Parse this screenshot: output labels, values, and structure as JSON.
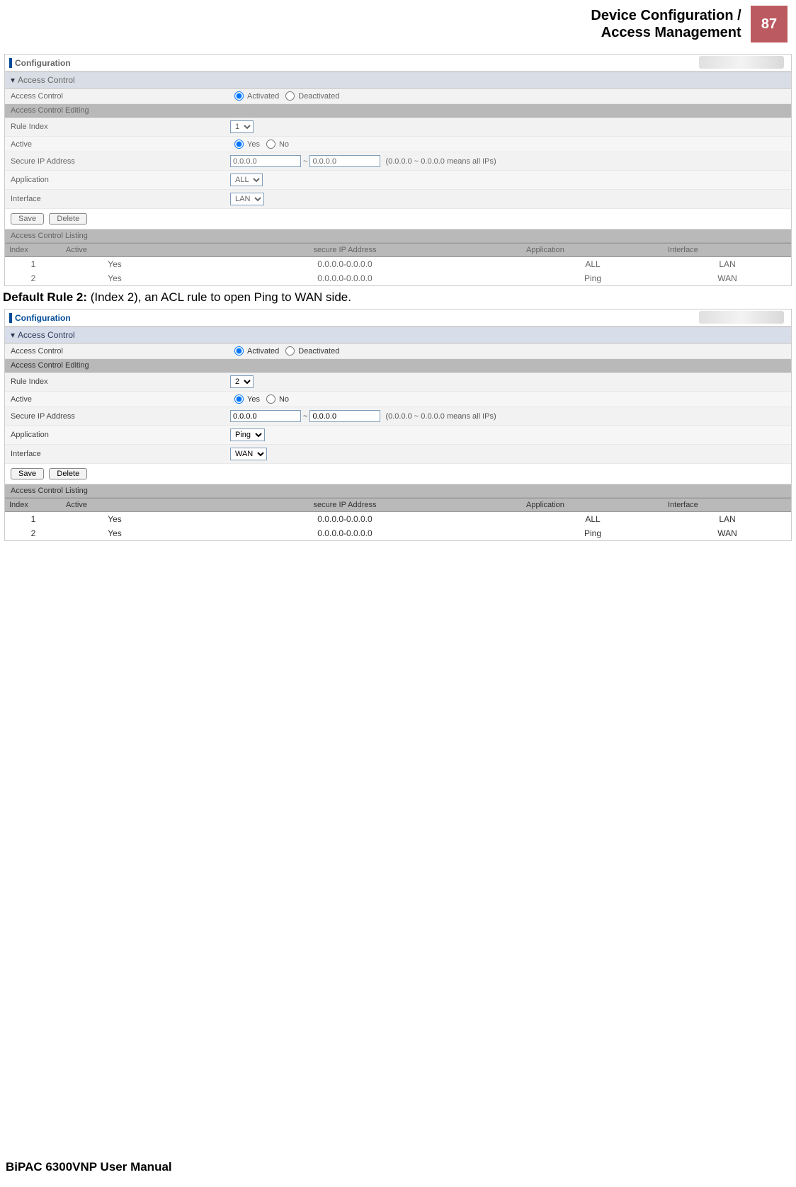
{
  "header": {
    "line1": "Device Configuration /",
    "line2": "Access Management",
    "page_no": "87"
  },
  "defaultRuleText": {
    "bold": "Default Rule 2:",
    "rest": " (Index 2), an ACL rule to open Ping to WAN side."
  },
  "footer": "BiPAC 6300VNP User Manual",
  "shot1": {
    "cfg": "Configuration",
    "sec": "Access Control",
    "labels": {
      "accessControl": "Access Control",
      "editing": "Access Control Editing",
      "ruleIndex": "Rule Index",
      "active": "Active",
      "secureIp": "Secure IP Address",
      "application": "Application",
      "interface": "Interface",
      "listing": "Access Control Listing"
    },
    "radios": {
      "activated": "Activated",
      "deactivated": "Deactivated",
      "yes": "Yes",
      "no": "No"
    },
    "ruleIndex": "1",
    "ip1": "0.0.0.0",
    "ipSep": "~",
    "ip2": "0.0.0.0",
    "ipHint": "(0.0.0.0 ~ 0.0.0.0 means all IPs)",
    "application": "ALL",
    "interface": "LAN",
    "buttons": {
      "save": "Save",
      "delete": "Delete"
    },
    "listHead": {
      "idx": "Index",
      "act": "Active",
      "ip": "secure IP Address",
      "app": "Application",
      "int": "Interface"
    },
    "list": [
      {
        "idx": "1",
        "act": "Yes",
        "ip": "0.0.0.0-0.0.0.0",
        "app": "ALL",
        "int": "LAN"
      },
      {
        "idx": "2",
        "act": "Yes",
        "ip": "0.0.0.0-0.0.0.0",
        "app": "Ping",
        "int": "WAN"
      }
    ]
  },
  "shot2": {
    "cfg": "Configuration",
    "sec": "Access Control",
    "labels": {
      "accessControl": "Access Control",
      "editing": "Access Control Editing",
      "ruleIndex": "Rule Index",
      "active": "Active",
      "secureIp": "Secure IP Address",
      "application": "Application",
      "interface": "Interface",
      "listing": "Access Control Listing"
    },
    "radios": {
      "activated": "Activated",
      "deactivated": "Deactivated",
      "yes": "Yes",
      "no": "No"
    },
    "ruleIndex": "2",
    "ip1": "0.0.0.0",
    "ipSep": "~",
    "ip2": "0.0.0.0",
    "ipHint": "(0.0.0.0 ~ 0.0.0.0 means all IPs)",
    "application": "Ping",
    "interface": "WAN",
    "buttons": {
      "save": "Save",
      "delete": "Delete"
    },
    "listHead": {
      "idx": "Index",
      "act": "Active",
      "ip": "secure IP Address",
      "app": "Application",
      "int": "Interface"
    },
    "list": [
      {
        "idx": "1",
        "act": "Yes",
        "ip": "0.0.0.0-0.0.0.0",
        "app": "ALL",
        "int": "LAN"
      },
      {
        "idx": "2",
        "act": "Yes",
        "ip": "0.0.0.0-0.0.0.0",
        "app": "Ping",
        "int": "WAN"
      }
    ]
  }
}
